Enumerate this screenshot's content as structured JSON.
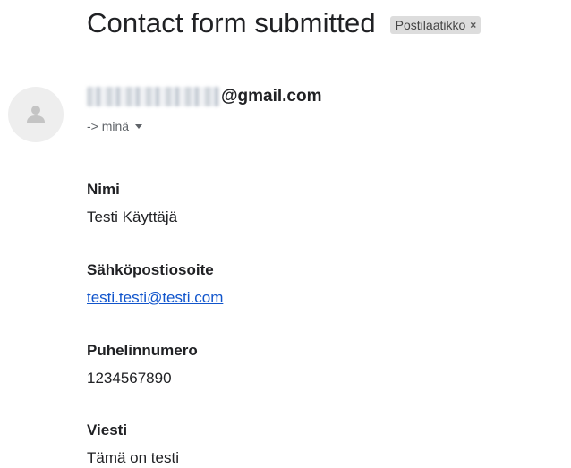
{
  "email": {
    "subject": "Contact form submitted",
    "label_chip": "Postilaatikko",
    "label_close": "×",
    "sender_domain": "@gmail.com",
    "recipient": "-> minä"
  },
  "fields": [
    {
      "label": "Nimi",
      "value": "Testi Käyttäjä"
    },
    {
      "label": "Sähköpostiosoite",
      "value": "testi.testi@testi.com"
    },
    {
      "label": "Puhelinnumero",
      "value": "1234567890"
    },
    {
      "label": "Viesti",
      "value": "Tämä on testi"
    }
  ],
  "colors": {
    "link": "#1155cc",
    "chip_background": "#dddddd",
    "avatar_background": "#eeeeee"
  },
  "icons": {
    "avatar": "person-icon",
    "recipient_caret": "caret-down-icon",
    "chip_close": "close-icon"
  }
}
